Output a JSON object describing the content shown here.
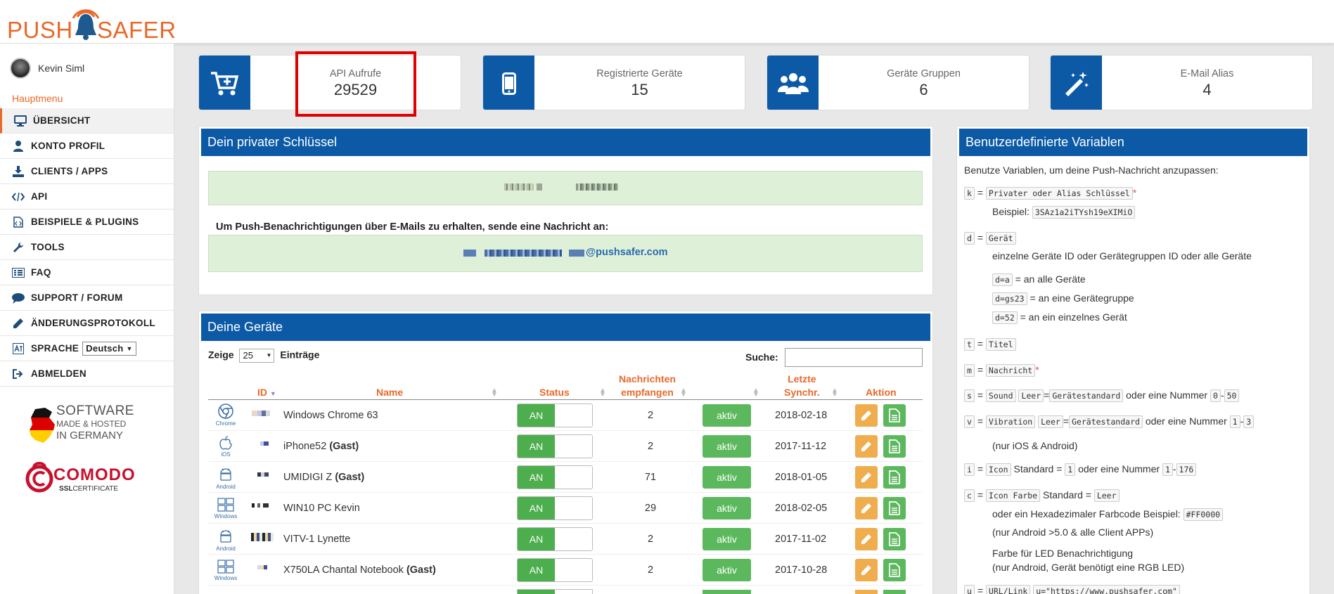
{
  "brand": {
    "left": "PUSH",
    "right": "SAFER"
  },
  "user": {
    "name": "Kevin Siml"
  },
  "menu": {
    "heading": "Hauptmenu",
    "items": [
      {
        "label": "ÜBERSICHT"
      },
      {
        "label": "KONTO PROFIL"
      },
      {
        "label": "CLIENTS / APPS"
      },
      {
        "label": "API"
      },
      {
        "label": "BEISPIELE & PLUGINS"
      },
      {
        "label": "TOOLS"
      },
      {
        "label": "FAQ"
      },
      {
        "label": "SUPPORT / FORUM"
      },
      {
        "label": "ÄNDERUNGSPROTOKOLL"
      },
      {
        "label": "SPRACHE"
      },
      {
        "label": "ABMELDEN"
      }
    ],
    "language": "Deutsch"
  },
  "badges": {
    "made": {
      "l1": "SOFTWARE",
      "l2": "MADE & HOSTED",
      "l3": "IN GERMANY"
    },
    "comodo": {
      "name": "COMODO",
      "ssl": "SSL",
      "cert": "CERTIFICATE"
    }
  },
  "stats": [
    {
      "label": "API Aufrufe",
      "value": "29529"
    },
    {
      "label": "Registrierte Geräte",
      "value": "15"
    },
    {
      "label": "Geräte Gruppen",
      "value": "6"
    },
    {
      "label": "E-Mail Alias",
      "value": "4"
    }
  ],
  "key_panel": {
    "title": "Dein privater Schlüssel",
    "email_text": "Um Push-Benachrichtigungen über E-Mails zu erhalten, sende eine Nachricht an:",
    "email_domain": "@pushsafer.com"
  },
  "devices": {
    "title": "Deine Geräte",
    "show_label": "Zeige",
    "entries_value": "25",
    "entries_label": "Einträge",
    "search_label": "Suche:",
    "columns": {
      "id": "ID",
      "name": "Name",
      "status": "Status",
      "received_l1": "Nachrichten",
      "received_l2": "empfangen",
      "sync_l1": "Letzte",
      "sync_l2": "Synchr.",
      "action": "Aktion"
    },
    "on_label": "AN",
    "active_label": "aktiv",
    "rows": [
      {
        "os": "Chrome",
        "name": "Windows Chrome 63",
        "guest": "",
        "count": "2",
        "sync": "2018-02-18"
      },
      {
        "os": "iOS",
        "name": "iPhone52",
        "guest": "(Gast)",
        "count": "2",
        "sync": "2017-11-12"
      },
      {
        "os": "Android",
        "name": "UMIDIGI Z",
        "guest": "(Gast)",
        "count": "71",
        "sync": "2018-01-05"
      },
      {
        "os": "Windows",
        "name": "WIN10 PC Kevin",
        "guest": "",
        "count": "29",
        "sync": "2018-02-05"
      },
      {
        "os": "Android",
        "name": "VITV-1 Lynette",
        "guest": "",
        "count": "2",
        "sync": "2017-11-02"
      },
      {
        "os": "Windows",
        "name": "X750LA Chantal Notebook",
        "guest": "(Gast)",
        "count": "2",
        "sync": "2017-10-28"
      }
    ]
  },
  "variables": {
    "title": "Benutzerdefinierte Variablen",
    "intro": "Benutze Variablen, um deine Push-Nachricht anzupassen:",
    "eq": "=",
    "k_code": "Privater oder Alias Schlüssel",
    "star": "*",
    "example_label": "Beispiel:",
    "example_code": "3SAz1a2iTYsh19eXIMiO",
    "d_code": "Gerät",
    "d_desc": "einzelne Geräte ID oder Gerätegruppen ID oder alle Geräte",
    "da_code": "d=a",
    "da_desc": "= an alle Geräte",
    "dgs_code": "d=gs23",
    "dgs_desc": "= an eine Gerätegruppe",
    "d52_code": "d=52",
    "d52_desc": "= an ein einzelnes Gerät",
    "t_code": "Titel",
    "m_code": "Nachricht",
    "s_code": "Sound",
    "leer": "Leer",
    "default_code": "Gerätestandard",
    "or_number": "oder eine Nummer",
    "s_from": "0",
    "s_to": "50",
    "dash": "-",
    "v_code": "Vibration",
    "v_from": "1",
    "v_to": "3",
    "v_note": "(nur iOS & Android)",
    "i_code": "Icon",
    "standard_label": "Standard =",
    "i_default": "1",
    "i_from": "1",
    "i_to": "176",
    "c_code": "Icon Farbe",
    "c_desc": "oder ein Hexadezimaler Farbcode Beispiel:",
    "c_example": "#FF0000",
    "c_note": "(nur Android >5.0 & alle Client APPs)",
    "led_1": "Farbe für LED Benachrichtigung",
    "led_2": "(nur Android, Gerät benötigt eine RGB LED)",
    "u_code": "URL/Link",
    "u_example": "u=\"https://www.pushsafer.com\""
  }
}
